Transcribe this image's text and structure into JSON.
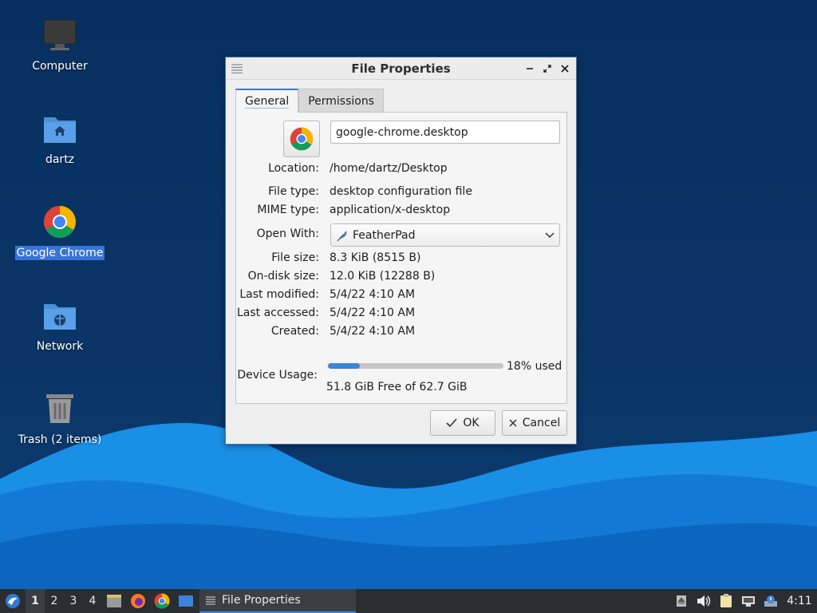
{
  "desktop": {
    "icons": [
      {
        "label": "Computer",
        "icon": "monitor-icon"
      },
      {
        "label": "dartz",
        "icon": "home-folder-icon"
      },
      {
        "label": "Google Chrome",
        "icon": "chrome-icon",
        "selected": true
      },
      {
        "label": "Network",
        "icon": "network-folder-icon"
      },
      {
        "label": "Trash (2 items)",
        "icon": "trash-icon"
      }
    ]
  },
  "window": {
    "title": "File Properties",
    "controls": {
      "minimize": "minimize-icon",
      "maximize": "maximize-icon",
      "close": "close-icon"
    },
    "tabs": [
      {
        "label": "General",
        "active": true
      },
      {
        "label": "Permissions",
        "active": false
      }
    ],
    "general": {
      "filename": "google-chrome.desktop",
      "location_label": "Location:",
      "location": "/home/dartz/Desktop",
      "file_type_label": "File type:",
      "file_type": "desktop configuration file",
      "mime_label": "MIME type:",
      "mime": "application/x-desktop",
      "open_with_label": "Open With:",
      "open_with": "FeatherPad",
      "file_size_label": "File size:",
      "file_size": "8.3 KiB (8515 B)",
      "disk_size_label": "On-disk size:",
      "disk_size": "12.0 KiB (12288 B)",
      "modified_label": "Last modified:",
      "modified": "5/4/22 4:10 AM",
      "accessed_label": "Last accessed:",
      "accessed": "5/4/22 4:10 AM",
      "created_label": "Created:",
      "created": "5/4/22 4:10 AM",
      "usage_label": "Device Usage:",
      "usage_percent_text": "18% used",
      "usage_fraction": 0.18,
      "usage_free": "51.8 GiB Free of 62.7 GiB"
    },
    "buttons": {
      "ok": "OK",
      "cancel": "Cancel"
    }
  },
  "taskbar": {
    "workspaces": [
      "1",
      "2",
      "3",
      "4"
    ],
    "active_workspace": "1",
    "task_label": "File Properties",
    "clock": "4:11"
  },
  "colors": {
    "accent": "#3c83dc",
    "selection": "#3874d8",
    "taskbar": "#2a2d31"
  }
}
